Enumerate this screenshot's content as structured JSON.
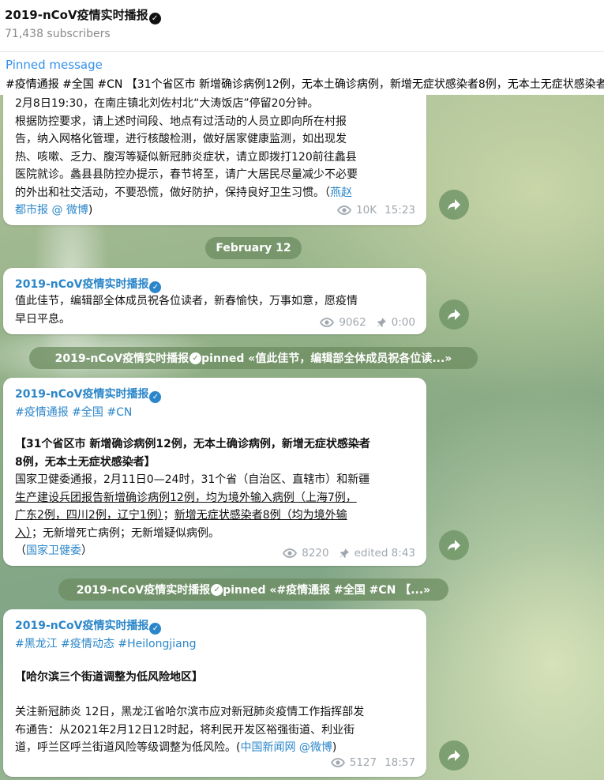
{
  "channel": {
    "title": "2019-nCoV疫情实时播报",
    "subscribers": "71,438 subscribers"
  },
  "pinned": {
    "label": "Pinned message",
    "text": "#疫情通报 #全国 #CN 【31个省区市 新增确诊病例12例，无本土确诊病例，新增无症状感染者8例，无本土无症状感染者】"
  },
  "messages": [
    {
      "text_lines": [
        "2月8日19:30，在南庄镇北刘佐村北“大涛饭店”停留20分钟。",
        "根据防控要求，请上述时间段、地点有过活动的人员立即向所在村报",
        "告，纳入网格化管理，进行核酸检测，做好居家健康监测，如出现发",
        "热、咳嗽、乏力、腹泻等疑似新冠肺炎症状，请立即拨打120前往蠡县",
        "医院就诊。蠡县县防控办提示，春节将至，请广大居民尽量减少不必要",
        "的外出和社交活动，不要恐慌，做好防护，保持良好卫生习惯。（"
      ],
      "source_a": "燕赵",
      "source_b": "都市报 @ 微博",
      "close": ")",
      "views": "10K",
      "time": "15:23"
    },
    {
      "sender": "2019-nCoV疫情实时播报",
      "text_line1": "值此佳节，编辑部全体成员祝各位读者，新春愉快，万事如意，愿疫情",
      "text_line2": "早日平息。",
      "views": "9062",
      "time": "0:00"
    },
    {
      "sender": "2019-nCoV疫情实时播报",
      "tags": "#疫情通报 #全国 #CN",
      "headline1": "【31个省区市 新增确诊病例12例，无本土确诊病例，新增无症状感染者",
      "headline2": "8例，无本土无症状感染者】",
      "body1": "国家卫健委通报，2月11日0—24时，31个省（自治区、直辖市）和新疆",
      "body2a": "生产建设兵团报告",
      "body2b": "新增确诊病例12例，均为境外输入病例（上海7例，",
      "body3": "广东2例，四川2例，辽宁1例）",
      "body3b": "；",
      "body3c": "新增无症状感染者8例（均为境外输",
      "body4a": "入）",
      "body4b": "；无新增死亡病例；无新增疑似病例。",
      "source_open": "（",
      "source": "国家卫健委",
      "source_close": "）",
      "views": "8220",
      "time": "edited 8:43"
    },
    {
      "sender": "2019-nCoV疫情实时播报",
      "tags": "#黑龙江 #疫情动态 #Heilongjiang",
      "headline": "【哈尔滨三个街道调整为低风险地区】",
      "body1": "关注新冠肺炎 12日，黑龙江省哈尔滨市应对新冠肺炎疫情工作指挥部发",
      "body2": "布通告：从2021年2月12日12时起，将利民开发区裕强街道、利业街",
      "body3": "道，呼兰区呼兰街道风险等级调整为低风险。(",
      "source": "中国新闻网 @微博",
      "close": ")",
      "views": "5127",
      "time": "18:57"
    }
  ],
  "service": {
    "date": "February 12",
    "pin1": "2019-nCoV疫情实时播报",
    "pin1_suffix": " pinned «值此佳节，编辑部全体成员祝各位读...»",
    "pin2": "2019-nCoV疫情实时播报",
    "pin2_suffix": " pinned «#疫情通报 #全国 #CN 【...»"
  },
  "icons": {
    "verified": "verified-icon",
    "views": "eye-icon",
    "pinned": "pin-icon",
    "forward": "forward-icon"
  },
  "colors": {
    "accent": "#2b86c9",
    "pinned_label": "#3390ec",
    "meta": "#a0a7ae"
  }
}
